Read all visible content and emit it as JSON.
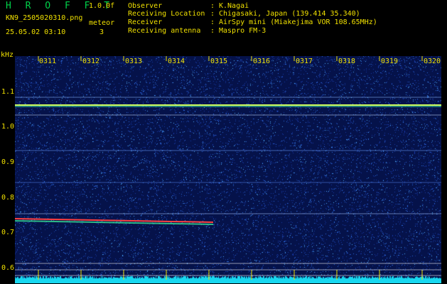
{
  "header": {
    "app_title": "H R O F F T",
    "version": "1.0.0f",
    "file_name": "KN9_2505020310.png",
    "meteor_label": "meteor",
    "timestamp": "25.05.02 03:10",
    "meteor_count": "3"
  },
  "info": [
    {
      "label": "Observer",
      "value": "K.Nagai"
    },
    {
      "label": "Receiving Location",
      "value": "Chigasaki, Japan (139.414 35.340)"
    },
    {
      "label": "Receiver",
      "value": "AirSpy mini (Miakejima VOR 108.65MHz)"
    },
    {
      "label": "Receiving antenna",
      "value": "Maspro FM-3"
    }
  ],
  "axis": {
    "unit": "kHz",
    "y_ticks": [
      "1.1",
      "1.0",
      "0.9",
      "0.8",
      "0.7",
      "0.6"
    ],
    "x_labels": [
      "0311",
      "0312",
      "0313",
      "0314",
      "0315",
      "0316",
      "0317",
      "0318",
      "0319",
      "0320"
    ]
  },
  "colors": {
    "text": "#f0e000",
    "title": "#00d24a",
    "background": "#05124a"
  }
}
